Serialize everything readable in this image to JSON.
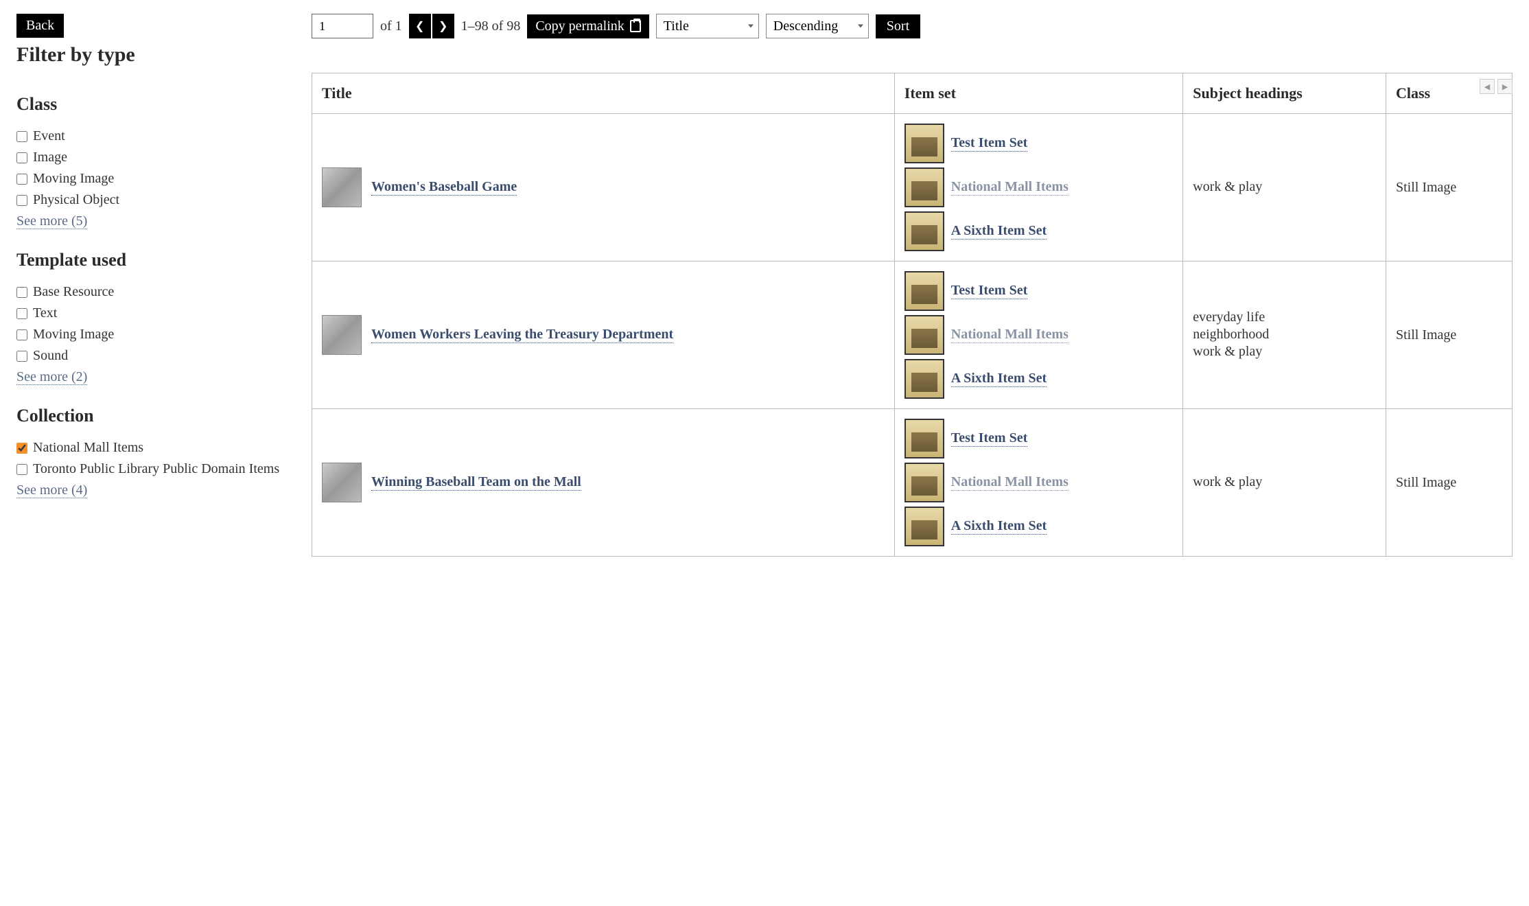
{
  "buttons": {
    "back": "Back",
    "copy_permalink": "Copy permalink",
    "sort": "Sort"
  },
  "sidebar": {
    "title": "Filter by type",
    "facets": [
      {
        "title": "Class",
        "items": [
          {
            "label": "Event",
            "checked": false
          },
          {
            "label": "Image",
            "checked": false
          },
          {
            "label": "Moving Image",
            "checked": false
          },
          {
            "label": "Physical Object",
            "checked": false
          }
        ],
        "see_more": "See more (5)"
      },
      {
        "title": "Template used",
        "items": [
          {
            "label": "Base Resource",
            "checked": false
          },
          {
            "label": "Text",
            "checked": false
          },
          {
            "label": "Moving Image",
            "checked": false
          },
          {
            "label": "Sound",
            "checked": false
          }
        ],
        "see_more": "See more (2)"
      },
      {
        "title": "Collection",
        "items": [
          {
            "label": "National Mall Items",
            "checked": true
          },
          {
            "label": "Toronto Public Library Public Domain Items",
            "checked": false
          }
        ],
        "see_more": "See more (4)"
      }
    ]
  },
  "pagination": {
    "page_input": "1",
    "of_label": "of 1",
    "range_label": "1–98 of 98"
  },
  "sort": {
    "field": "Title",
    "order": "Descending"
  },
  "table": {
    "headers": {
      "title": "Title",
      "item_set": "Item set",
      "subject": "Subject headings",
      "class": "Class"
    },
    "rows": [
      {
        "title": "Women's Baseball Game",
        "item_sets": [
          {
            "label": "Test Item Set",
            "muted": false
          },
          {
            "label": "National Mall Items",
            "muted": true
          },
          {
            "label": "A Sixth Item Set",
            "muted": false
          }
        ],
        "subjects": [
          "work & play"
        ],
        "class": "Still Image"
      },
      {
        "title": "Women Workers Leaving the Treasury Department",
        "item_sets": [
          {
            "label": "Test Item Set",
            "muted": false
          },
          {
            "label": "National Mall Items",
            "muted": true
          },
          {
            "label": "A Sixth Item Set",
            "muted": false
          }
        ],
        "subjects": [
          "everyday life",
          "neighborhood",
          "work & play"
        ],
        "class": "Still Image"
      },
      {
        "title": "Winning Baseball Team on the Mall",
        "item_sets": [
          {
            "label": "Test Item Set",
            "muted": false
          },
          {
            "label": "National Mall Items",
            "muted": true
          },
          {
            "label": "A Sixth Item Set",
            "muted": false
          }
        ],
        "subjects": [
          "work & play"
        ],
        "class": "Still Image"
      }
    ]
  }
}
